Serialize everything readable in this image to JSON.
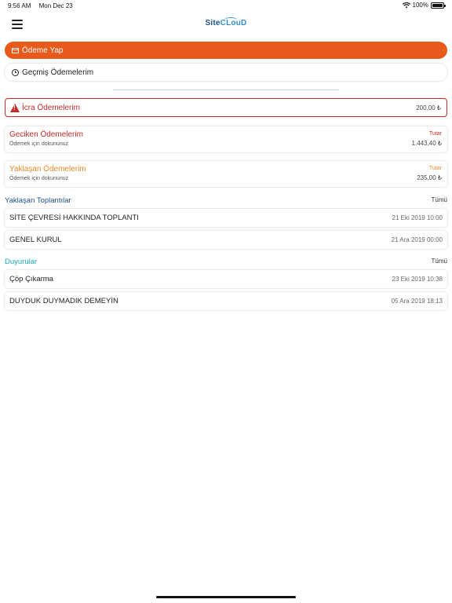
{
  "status_bar": {
    "time": "9:56 AM",
    "date": "Mon Dec 23",
    "battery": "100%",
    "battery_level": 1.0
  },
  "header": {
    "logo_part1": "Site",
    "logo_part2": "CLouD",
    "menu_icon": "hamburger-icon"
  },
  "buttons": {
    "pay_label": "Ödeme Yap",
    "pay_icon": "credit-card-icon",
    "history_label": "Geçmiş Ödemelerim",
    "history_icon": "clock-icon"
  },
  "icra": {
    "title": "İcra Ödemelerim",
    "amount": "200,00 ₺",
    "icon": "warning-icon"
  },
  "overdue": {
    "title": "Geciken Ödemelerim",
    "subtitle": "Ödemek için dokununuz",
    "amount_label": "Tutar",
    "amount": "1.443,40 ₺"
  },
  "upcoming_payments": {
    "title": "Yaklaşan Ödemelerim",
    "subtitle": "Ödemek için dokununuz",
    "amount_label": "Tutar",
    "amount": "235,00 ₺"
  },
  "meetings": {
    "title": "Yaklaşan Toplantılar",
    "all_label": "Tümü",
    "items": [
      {
        "title": "SİTE ÇEVRESİ HAKKINDA TOPLANTI",
        "date": "21 Eki 2019 10:00"
      },
      {
        "title": "GENEL KURUL",
        "date": "21 Ara 2019 00:00"
      }
    ]
  },
  "announcements": {
    "title": "Duyurular",
    "all_label": "Tümü",
    "items": [
      {
        "title": "Çöp Çıkarma",
        "date": "23 Eki 2019 10:38"
      },
      {
        "title": "DUYDUK DUYMADIK DEMEYİN",
        "date": "05 Ara 2019 18:13"
      }
    ]
  },
  "colors": {
    "primary": "#e85a1b",
    "danger": "#c62a2a",
    "warning": "#e8892a",
    "section_blue": "#1b4f8a",
    "section_teal": "#17a9b8"
  }
}
